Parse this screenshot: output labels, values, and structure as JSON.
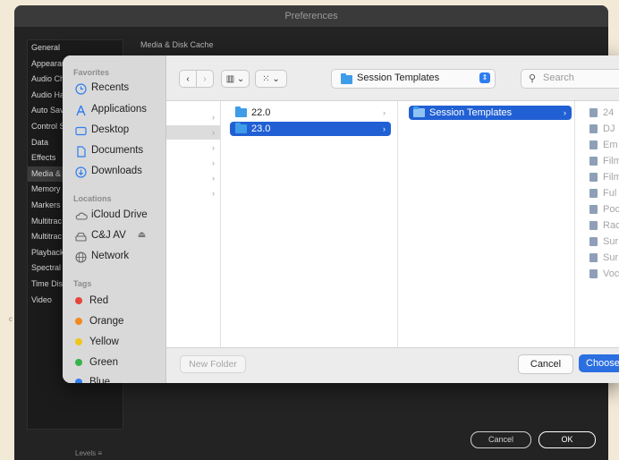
{
  "preferences": {
    "title": "Preferences",
    "section_title": "Media & Disk Cache",
    "categories": [
      "General",
      "Appearan",
      "Audio Ch",
      "Audio Ha",
      "Auto Sav",
      "Control S",
      "Data",
      "Effects",
      "Media &",
      "Memory",
      "Markers",
      "Multitrac",
      "Multitrac",
      "Playback",
      "Spectral",
      "Time Dis",
      "Video"
    ],
    "cancel_label": "Cancel",
    "ok_label": "OK",
    "bottom_text": "Levels  ≡",
    "left_edge": "c"
  },
  "dialog": {
    "sidebar": {
      "favorites_heading": "Favorites",
      "favorites": [
        "Recents",
        "Applications",
        "Desktop",
        "Documents",
        "Downloads"
      ],
      "locations_heading": "Locations",
      "locations": [
        "iCloud Drive",
        "C&J AV",
        "Network"
      ],
      "tags_heading": "Tags",
      "tags": [
        {
          "name": "Red",
          "color": "#e5453a"
        },
        {
          "name": "Orange",
          "color": "#f08a1c"
        },
        {
          "name": "Yellow",
          "color": "#f2c51c"
        },
        {
          "name": "Green",
          "color": "#35b34a"
        },
        {
          "name": "Blue",
          "color": "#2f7ef0"
        }
      ]
    },
    "toolbar": {
      "back_glyph": "‹",
      "forward_glyph": "›",
      "view_glyph": "▥ ⌄",
      "group_glyph": "⁙ ⌄",
      "path_label": "Session Templates",
      "search_placeholder": "Search"
    },
    "columns": {
      "col2": [
        "22.0",
        "23.0"
      ],
      "col3": [
        "Session Templates"
      ],
      "col4": [
        "24",
        "DJ",
        "Em",
        "Film",
        "Film",
        "Ful",
        "Poc",
        "Rac",
        "Sur",
        "Sur",
        "Voc"
      ]
    },
    "footer": {
      "new_folder": "New Folder",
      "cancel": "Cancel",
      "choose": "Choose"
    }
  }
}
